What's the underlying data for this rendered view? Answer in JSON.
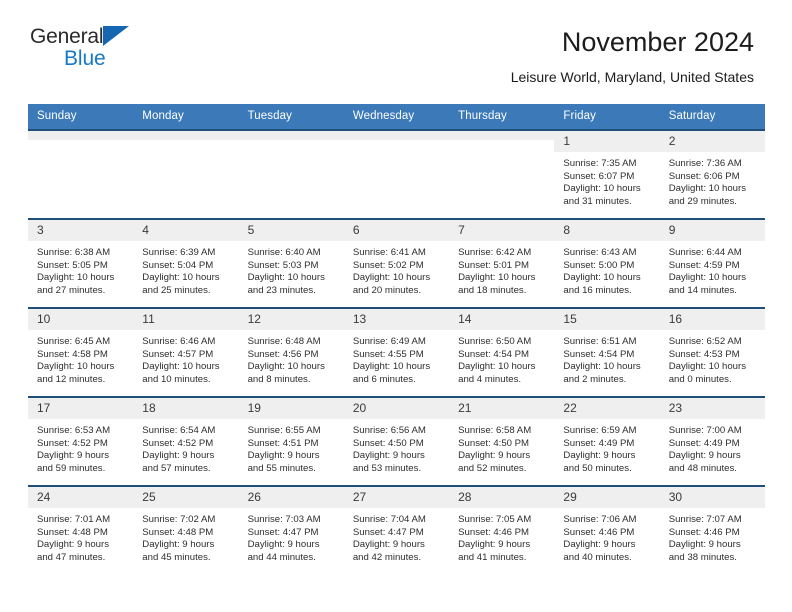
{
  "brand": {
    "name_part1": "General",
    "name_part2": "Blue",
    "triangle_color": "#1567b2",
    "blue_text_color": "#1878c8"
  },
  "header": {
    "title": "November 2024",
    "subtitle": "Leisure World, Maryland, United States"
  },
  "theme": {
    "header_row_bg": "#3b79b9",
    "cell_top_border": "#1f4e79",
    "daynum_bg": "#efefef"
  },
  "weekday_headers": [
    "Sunday",
    "Monday",
    "Tuesday",
    "Wednesday",
    "Thursday",
    "Friday",
    "Saturday"
  ],
  "weeks": [
    [
      {
        "day": "",
        "sunrise": "",
        "sunset": "",
        "daylight_line1": "",
        "daylight_line2": ""
      },
      {
        "day": "",
        "sunrise": "",
        "sunset": "",
        "daylight_line1": "",
        "daylight_line2": ""
      },
      {
        "day": "",
        "sunrise": "",
        "sunset": "",
        "daylight_line1": "",
        "daylight_line2": ""
      },
      {
        "day": "",
        "sunrise": "",
        "sunset": "",
        "daylight_line1": "",
        "daylight_line2": ""
      },
      {
        "day": "",
        "sunrise": "",
        "sunset": "",
        "daylight_line1": "",
        "daylight_line2": ""
      },
      {
        "day": "1",
        "sunrise": "Sunrise: 7:35 AM",
        "sunset": "Sunset: 6:07 PM",
        "daylight_line1": "Daylight: 10 hours",
        "daylight_line2": "and 31 minutes."
      },
      {
        "day": "2",
        "sunrise": "Sunrise: 7:36 AM",
        "sunset": "Sunset: 6:06 PM",
        "daylight_line1": "Daylight: 10 hours",
        "daylight_line2": "and 29 minutes."
      }
    ],
    [
      {
        "day": "3",
        "sunrise": "Sunrise: 6:38 AM",
        "sunset": "Sunset: 5:05 PM",
        "daylight_line1": "Daylight: 10 hours",
        "daylight_line2": "and 27 minutes."
      },
      {
        "day": "4",
        "sunrise": "Sunrise: 6:39 AM",
        "sunset": "Sunset: 5:04 PM",
        "daylight_line1": "Daylight: 10 hours",
        "daylight_line2": "and 25 minutes."
      },
      {
        "day": "5",
        "sunrise": "Sunrise: 6:40 AM",
        "sunset": "Sunset: 5:03 PM",
        "daylight_line1": "Daylight: 10 hours",
        "daylight_line2": "and 23 minutes."
      },
      {
        "day": "6",
        "sunrise": "Sunrise: 6:41 AM",
        "sunset": "Sunset: 5:02 PM",
        "daylight_line1": "Daylight: 10 hours",
        "daylight_line2": "and 20 minutes."
      },
      {
        "day": "7",
        "sunrise": "Sunrise: 6:42 AM",
        "sunset": "Sunset: 5:01 PM",
        "daylight_line1": "Daylight: 10 hours",
        "daylight_line2": "and 18 minutes."
      },
      {
        "day": "8",
        "sunrise": "Sunrise: 6:43 AM",
        "sunset": "Sunset: 5:00 PM",
        "daylight_line1": "Daylight: 10 hours",
        "daylight_line2": "and 16 minutes."
      },
      {
        "day": "9",
        "sunrise": "Sunrise: 6:44 AM",
        "sunset": "Sunset: 4:59 PM",
        "daylight_line1": "Daylight: 10 hours",
        "daylight_line2": "and 14 minutes."
      }
    ],
    [
      {
        "day": "10",
        "sunrise": "Sunrise: 6:45 AM",
        "sunset": "Sunset: 4:58 PM",
        "daylight_line1": "Daylight: 10 hours",
        "daylight_line2": "and 12 minutes."
      },
      {
        "day": "11",
        "sunrise": "Sunrise: 6:46 AM",
        "sunset": "Sunset: 4:57 PM",
        "daylight_line1": "Daylight: 10 hours",
        "daylight_line2": "and 10 minutes."
      },
      {
        "day": "12",
        "sunrise": "Sunrise: 6:48 AM",
        "sunset": "Sunset: 4:56 PM",
        "daylight_line1": "Daylight: 10 hours",
        "daylight_line2": "and 8 minutes."
      },
      {
        "day": "13",
        "sunrise": "Sunrise: 6:49 AM",
        "sunset": "Sunset: 4:55 PM",
        "daylight_line1": "Daylight: 10 hours",
        "daylight_line2": "and 6 minutes."
      },
      {
        "day": "14",
        "sunrise": "Sunrise: 6:50 AM",
        "sunset": "Sunset: 4:54 PM",
        "daylight_line1": "Daylight: 10 hours",
        "daylight_line2": "and 4 minutes."
      },
      {
        "day": "15",
        "sunrise": "Sunrise: 6:51 AM",
        "sunset": "Sunset: 4:54 PM",
        "daylight_line1": "Daylight: 10 hours",
        "daylight_line2": "and 2 minutes."
      },
      {
        "day": "16",
        "sunrise": "Sunrise: 6:52 AM",
        "sunset": "Sunset: 4:53 PM",
        "daylight_line1": "Daylight: 10 hours",
        "daylight_line2": "and 0 minutes."
      }
    ],
    [
      {
        "day": "17",
        "sunrise": "Sunrise: 6:53 AM",
        "sunset": "Sunset: 4:52 PM",
        "daylight_line1": "Daylight: 9 hours",
        "daylight_line2": "and 59 minutes."
      },
      {
        "day": "18",
        "sunrise": "Sunrise: 6:54 AM",
        "sunset": "Sunset: 4:52 PM",
        "daylight_line1": "Daylight: 9 hours",
        "daylight_line2": "and 57 minutes."
      },
      {
        "day": "19",
        "sunrise": "Sunrise: 6:55 AM",
        "sunset": "Sunset: 4:51 PM",
        "daylight_line1": "Daylight: 9 hours",
        "daylight_line2": "and 55 minutes."
      },
      {
        "day": "20",
        "sunrise": "Sunrise: 6:56 AM",
        "sunset": "Sunset: 4:50 PM",
        "daylight_line1": "Daylight: 9 hours",
        "daylight_line2": "and 53 minutes."
      },
      {
        "day": "21",
        "sunrise": "Sunrise: 6:58 AM",
        "sunset": "Sunset: 4:50 PM",
        "daylight_line1": "Daylight: 9 hours",
        "daylight_line2": "and 52 minutes."
      },
      {
        "day": "22",
        "sunrise": "Sunrise: 6:59 AM",
        "sunset": "Sunset: 4:49 PM",
        "daylight_line1": "Daylight: 9 hours",
        "daylight_line2": "and 50 minutes."
      },
      {
        "day": "23",
        "sunrise": "Sunrise: 7:00 AM",
        "sunset": "Sunset: 4:49 PM",
        "daylight_line1": "Daylight: 9 hours",
        "daylight_line2": "and 48 minutes."
      }
    ],
    [
      {
        "day": "24",
        "sunrise": "Sunrise: 7:01 AM",
        "sunset": "Sunset: 4:48 PM",
        "daylight_line1": "Daylight: 9 hours",
        "daylight_line2": "and 47 minutes."
      },
      {
        "day": "25",
        "sunrise": "Sunrise: 7:02 AM",
        "sunset": "Sunset: 4:48 PM",
        "daylight_line1": "Daylight: 9 hours",
        "daylight_line2": "and 45 minutes."
      },
      {
        "day": "26",
        "sunrise": "Sunrise: 7:03 AM",
        "sunset": "Sunset: 4:47 PM",
        "daylight_line1": "Daylight: 9 hours",
        "daylight_line2": "and 44 minutes."
      },
      {
        "day": "27",
        "sunrise": "Sunrise: 7:04 AM",
        "sunset": "Sunset: 4:47 PM",
        "daylight_line1": "Daylight: 9 hours",
        "daylight_line2": "and 42 minutes."
      },
      {
        "day": "28",
        "sunrise": "Sunrise: 7:05 AM",
        "sunset": "Sunset: 4:46 PM",
        "daylight_line1": "Daylight: 9 hours",
        "daylight_line2": "and 41 minutes."
      },
      {
        "day": "29",
        "sunrise": "Sunrise: 7:06 AM",
        "sunset": "Sunset: 4:46 PM",
        "daylight_line1": "Daylight: 9 hours",
        "daylight_line2": "and 40 minutes."
      },
      {
        "day": "30",
        "sunrise": "Sunrise: 7:07 AM",
        "sunset": "Sunset: 4:46 PM",
        "daylight_line1": "Daylight: 9 hours",
        "daylight_line2": "and 38 minutes."
      }
    ]
  ]
}
